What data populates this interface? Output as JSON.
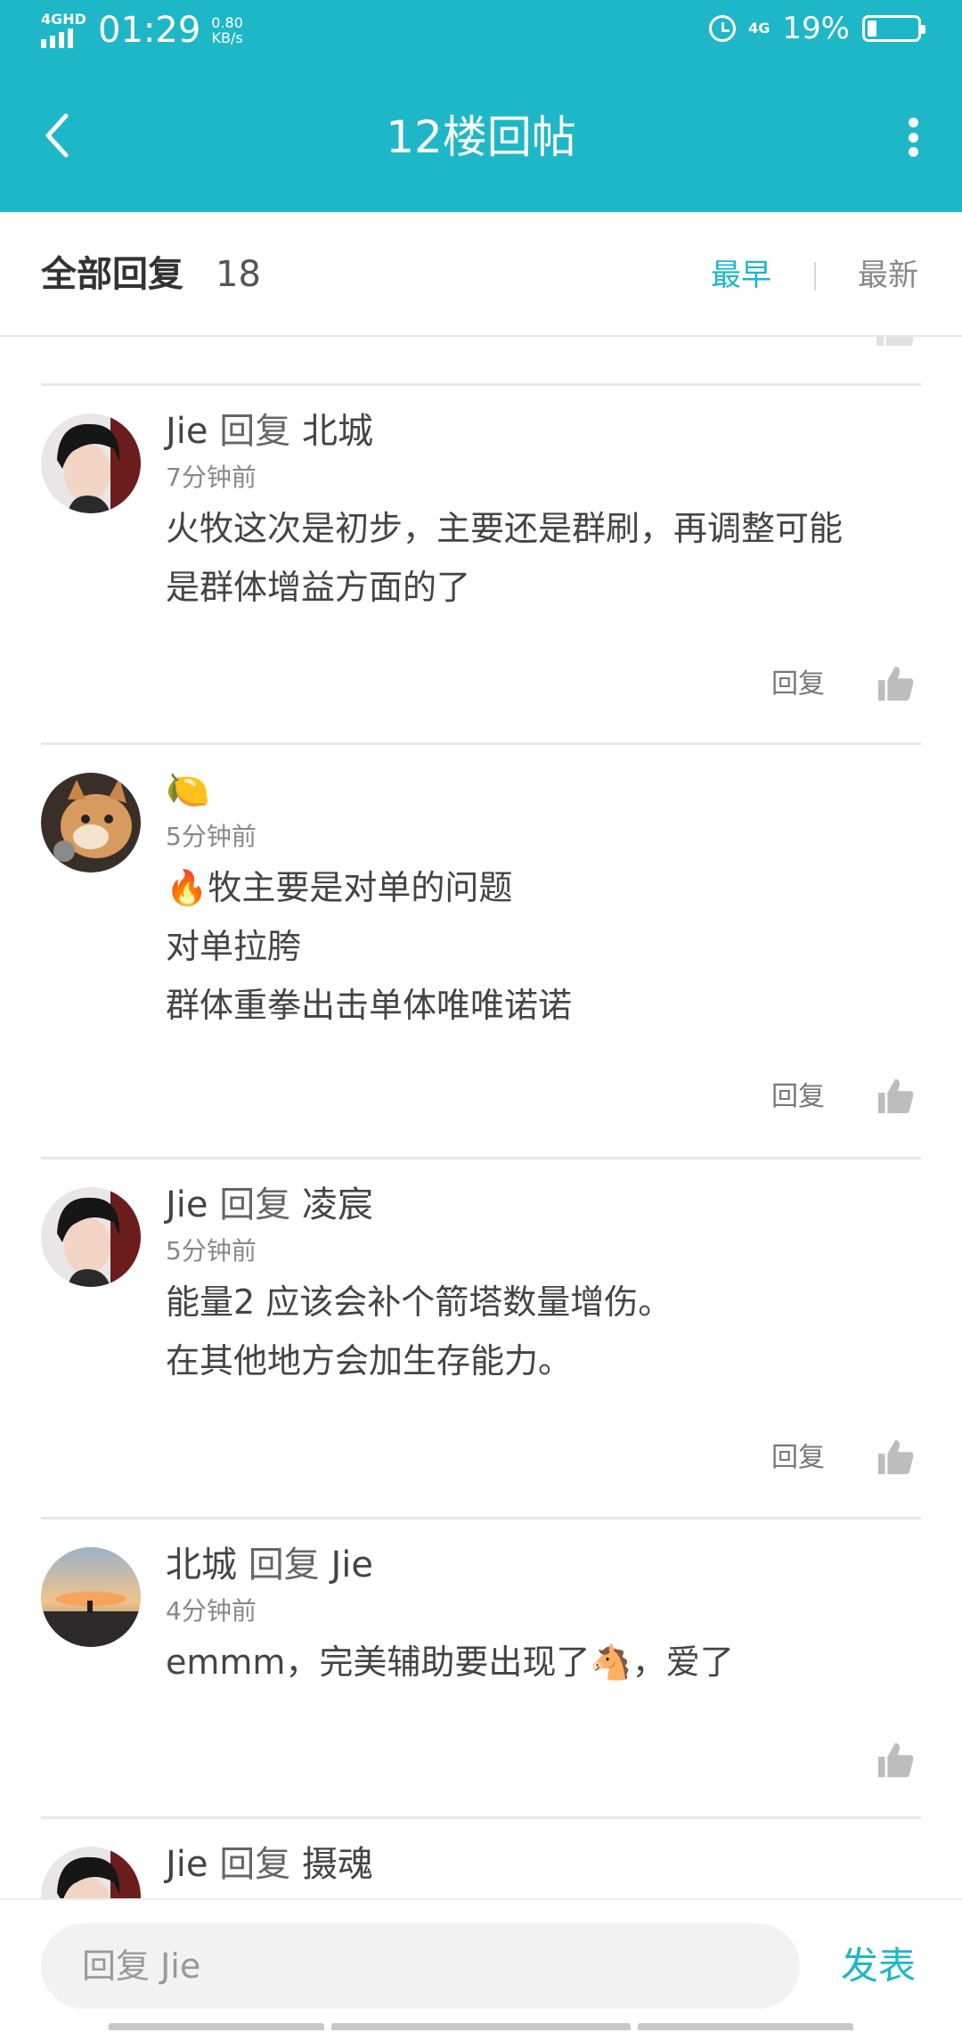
{
  "status_bar": {
    "network": "4GHD",
    "time": "01:29",
    "speed_value": "0.80",
    "speed_unit": "KB/s",
    "network_right": "4G",
    "battery": "19%",
    "battery_level": 0.19
  },
  "header": {
    "title": "12楼回帖"
  },
  "tabs": {
    "all_label": "全部回复",
    "count": "18",
    "sort_early": "最早",
    "sort_new": "最新"
  },
  "comments": [
    {
      "author": "Jie",
      "reply_word": "回复",
      "target": "北城",
      "time": "7分钟前",
      "lines": [
        "火牧这次是初步，主要还是群刷，再调整可能",
        "是群体增益方面的了"
      ],
      "reply_label": "回复",
      "avatar": "avatar-young-man"
    },
    {
      "author": "🍋",
      "time": "5分钟前",
      "lines": [
        "🔥牧主要是对单的问题",
        "对单拉胯",
        "群体重拳出击单体唯唯诺诺"
      ],
      "reply_label": "回复",
      "avatar": "avatar-cat"
    },
    {
      "author": "Jie",
      "reply_word": "回复",
      "target": "凌宸",
      "time": "5分钟前",
      "lines": [
        "能量2 应该会补个箭塔数量增伤。",
        "在其他地方会加生存能力。"
      ],
      "reply_label": "回复",
      "avatar": "avatar-young-man"
    },
    {
      "author": "北城",
      "reply_word": "回复",
      "target": "Jie",
      "time": "4分钟前",
      "lines": [
        "emmm，完美辅助要出现了🐴，爱了"
      ],
      "avatar": "avatar-sunset"
    },
    {
      "author": "Jie",
      "reply_word": "回复",
      "target": "摄魂",
      "avatar": "avatar-young-man"
    }
  ],
  "composer": {
    "placeholder": "回复 Jie",
    "send_label": "发表"
  },
  "colors": {
    "accent": "#1eb7c8",
    "header_bg": "#1eb7c8"
  },
  "icons": [
    "back-icon",
    "more-vertical-icon",
    "thumb-up-icon",
    "alarm-icon",
    "battery-icon",
    "signal-icon"
  ]
}
